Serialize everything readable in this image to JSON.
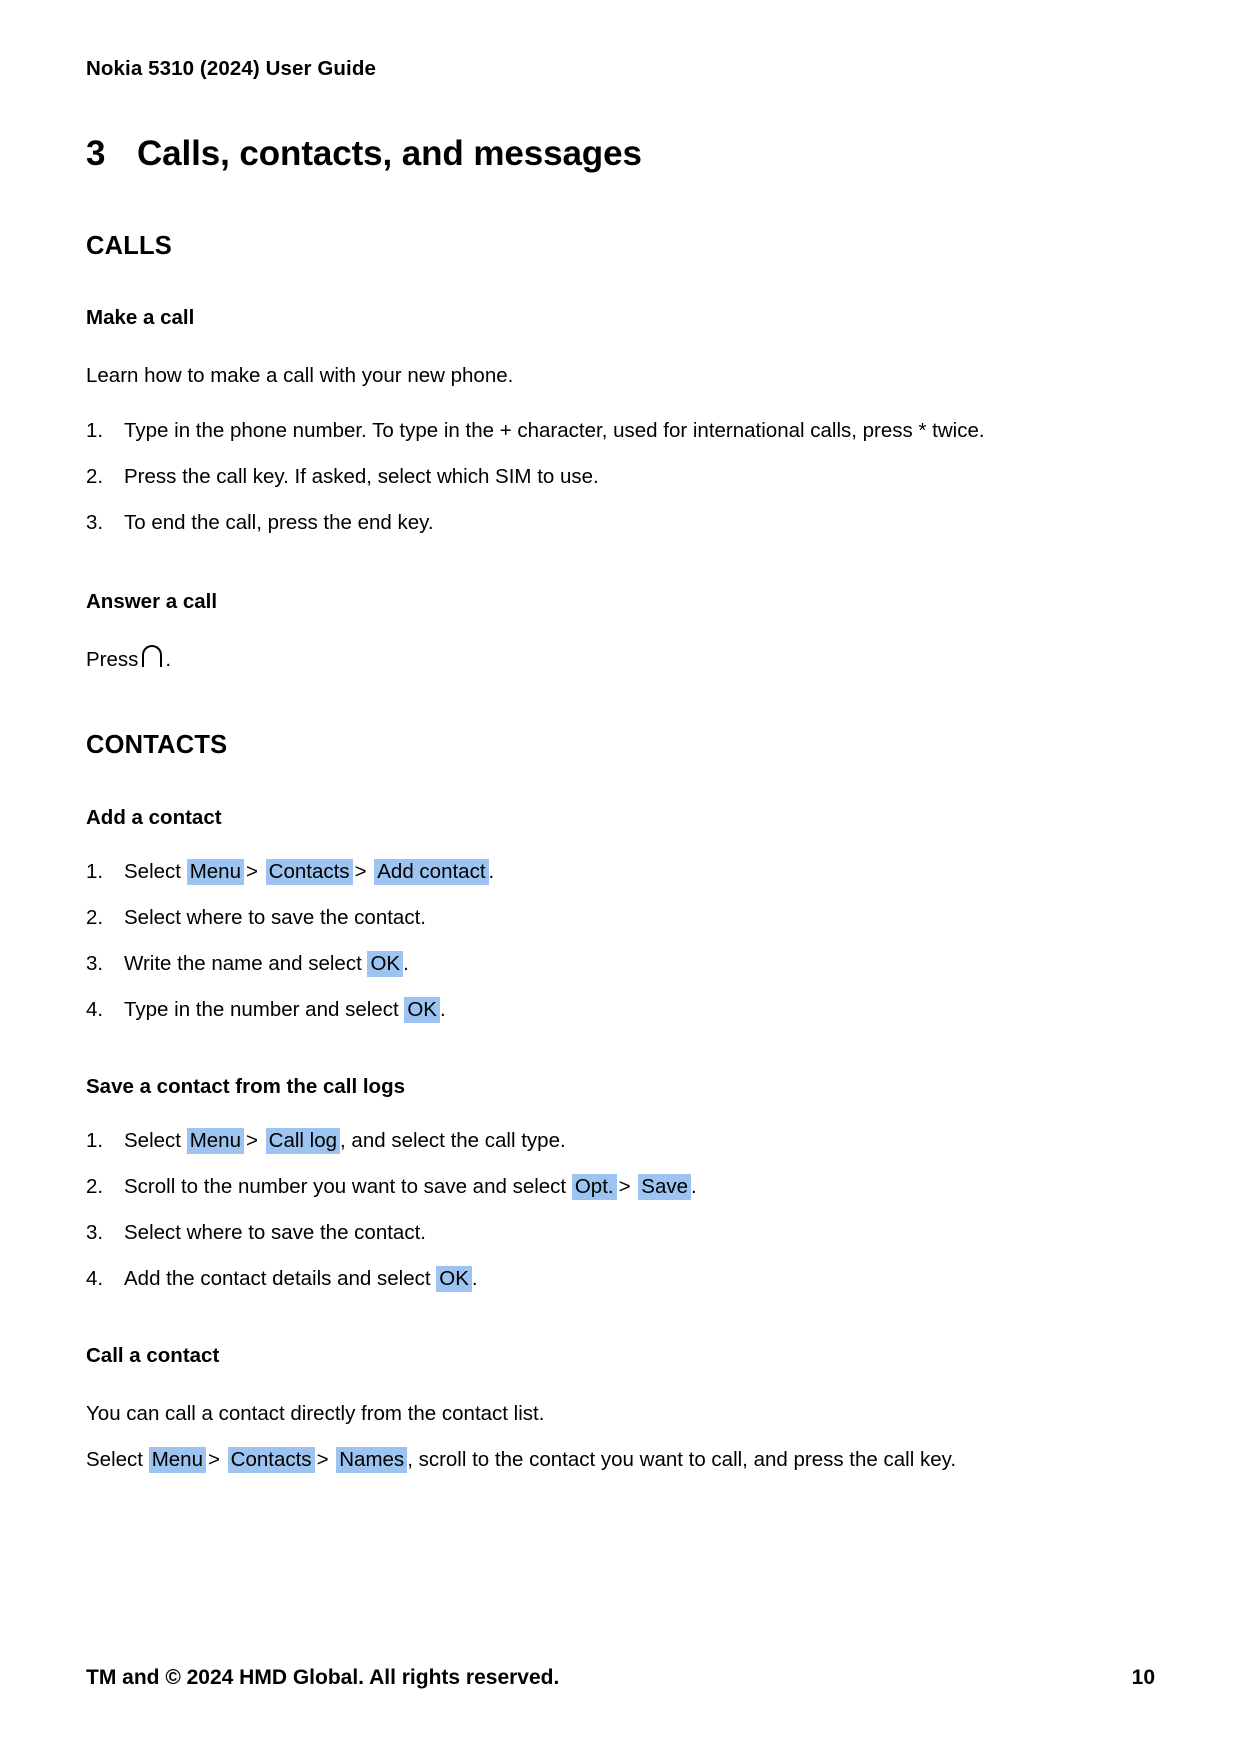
{
  "header": {
    "running_head": "Nokia 5310 (2024) User Guide"
  },
  "chapter": {
    "number": "3",
    "title": "Calls, contacts, and messages"
  },
  "sections": [
    {
      "id": "calls",
      "heading": "CALLS",
      "subsections": [
        {
          "id": "make-a-call",
          "heading": "Make a call",
          "intro": "Learn how to make a call with your new phone.",
          "steps": [
            {
              "marker": "1.",
              "text": "Type in the phone number. To type in the + character, used for international calls, press * twice."
            },
            {
              "marker": "2.",
              "text": "Press the call key. If asked, select which SIM to use."
            },
            {
              "marker": "3.",
              "text": "To end the call, press the end key."
            }
          ]
        },
        {
          "id": "answer-a-call",
          "heading": "Answer a call",
          "press_label": "Press",
          "press_icon": "call-key-icon",
          "press_period": "."
        }
      ]
    },
    {
      "id": "contacts",
      "heading": "CONTACTS",
      "subsections": [
        {
          "id": "add-a-contact",
          "heading": "Add a contact",
          "steps": [
            {
              "marker": "1.",
              "parts": {
                "lead": "Select",
                "key1": "Menu",
                "sep1": ">",
                "key2": "Contacts",
                "sep2": ">",
                "key3": "Add contact",
                "tail": "."
              }
            },
            {
              "marker": "2.",
              "text": "Select where to save the contact."
            },
            {
              "marker": "3.",
              "parts": {
                "lead": "Write the name and select",
                "key1": "OK",
                "tail": "."
              }
            },
            {
              "marker": "4.",
              "parts": {
                "lead": "Type in the number and select",
                "key1": "OK",
                "tail": "."
              }
            }
          ]
        },
        {
          "id": "save-a-contact-from-the-call-logs",
          "heading": "Save a contact from the call logs",
          "steps": [
            {
              "marker": "1.",
              "parts": {
                "lead": "Select",
                "key1": "Menu",
                "sep1": ">",
                "key2": "Call log",
                "tail": ", and select the call type."
              }
            },
            {
              "marker": "2.",
              "parts": {
                "lead": "Scroll to the number you want to save and select",
                "key1": "Opt.",
                "sep1": ">",
                "key2": "Save",
                "tail": "."
              }
            },
            {
              "marker": "3.",
              "text": "Select where to save the contact."
            },
            {
              "marker": "4.",
              "parts": {
                "lead": "Add the contact details and select",
                "key1": "OK",
                "tail": "."
              }
            }
          ]
        },
        {
          "id": "call-a-contact",
          "heading": "Call a contact",
          "intro": "You can call a contact directly from the contact list.",
          "instruction": {
            "lead": "Select",
            "key1": "Menu",
            "sep1": ">",
            "key2": "Contacts",
            "sep2": ">",
            "key3": "Names",
            "tail": ", scroll to the contact you want to call, and press the call key."
          }
        }
      ]
    }
  ],
  "footer": {
    "copyright": "TM and © 2024 HMD Global. All rights reserved.",
    "page_number": "10"
  },
  "colors": {
    "highlight": "#9dc3f0",
    "text": "#000000",
    "background": "#ffffff"
  }
}
